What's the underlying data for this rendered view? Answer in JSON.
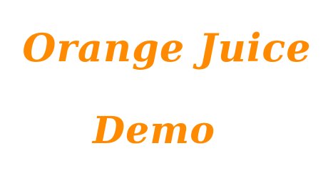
{
  "text": {
    "line1": "Orange Juice",
    "line2": "Demo"
  },
  "colors": {
    "text": "#FF8A00",
    "background": "#FFFFFF"
  }
}
